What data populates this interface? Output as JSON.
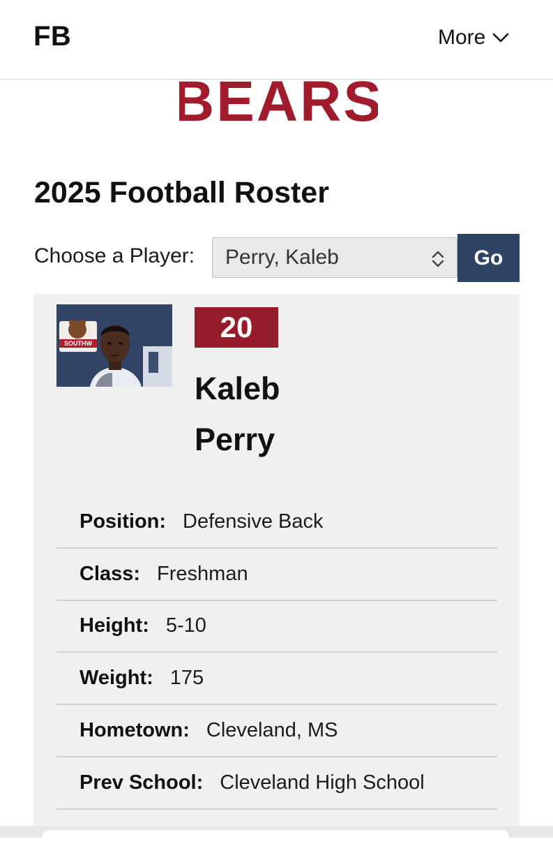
{
  "header": {
    "site_title": "FB",
    "more_label": "More",
    "more_icon": "chevron-down-icon"
  },
  "logo": {
    "wordmark": "BEARS",
    "color": "#a01c2d"
  },
  "page": {
    "title": "2025 Football Roster"
  },
  "chooser": {
    "label": "Choose a Player:",
    "selected": "Perry, Kaleb",
    "go_label": "Go"
  },
  "player": {
    "number": "20",
    "first_name": "Kaleb",
    "last_name": "Perry",
    "photo_logo_text": "SOUTHW",
    "details": [
      {
        "label": "Position:",
        "value": "Defensive Back"
      },
      {
        "label": "Class:",
        "value": "Freshman"
      },
      {
        "label": "Height:",
        "value": "5-10"
      },
      {
        "label": "Weight:",
        "value": "175"
      },
      {
        "label": "Hometown:",
        "value": "Cleveland, MS"
      },
      {
        "label": "Prev School:",
        "value": "Cleveland High School"
      }
    ]
  },
  "colors": {
    "accent_red": "#951c2a",
    "button_navy": "#2f4465",
    "card_bg": "#f0f0f0"
  }
}
